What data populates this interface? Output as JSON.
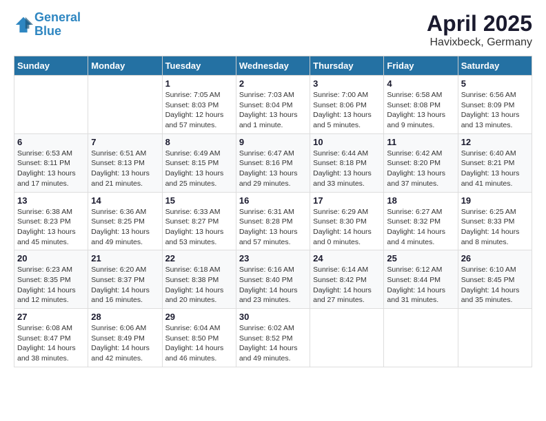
{
  "header": {
    "logo_line1": "General",
    "logo_line2": "Blue",
    "title": "April 2025",
    "subtitle": "Havixbeck, Germany"
  },
  "columns": [
    "Sunday",
    "Monday",
    "Tuesday",
    "Wednesday",
    "Thursday",
    "Friday",
    "Saturday"
  ],
  "weeks": [
    [
      {
        "day": "",
        "sunrise": "",
        "sunset": "",
        "daylight": ""
      },
      {
        "day": "",
        "sunrise": "",
        "sunset": "",
        "daylight": ""
      },
      {
        "day": "1",
        "sunrise": "Sunrise: 7:05 AM",
        "sunset": "Sunset: 8:03 PM",
        "daylight": "Daylight: 12 hours and 57 minutes."
      },
      {
        "day": "2",
        "sunrise": "Sunrise: 7:03 AM",
        "sunset": "Sunset: 8:04 PM",
        "daylight": "Daylight: 13 hours and 1 minute."
      },
      {
        "day": "3",
        "sunrise": "Sunrise: 7:00 AM",
        "sunset": "Sunset: 8:06 PM",
        "daylight": "Daylight: 13 hours and 5 minutes."
      },
      {
        "day": "4",
        "sunrise": "Sunrise: 6:58 AM",
        "sunset": "Sunset: 8:08 PM",
        "daylight": "Daylight: 13 hours and 9 minutes."
      },
      {
        "day": "5",
        "sunrise": "Sunrise: 6:56 AM",
        "sunset": "Sunset: 8:09 PM",
        "daylight": "Daylight: 13 hours and 13 minutes."
      }
    ],
    [
      {
        "day": "6",
        "sunrise": "Sunrise: 6:53 AM",
        "sunset": "Sunset: 8:11 PM",
        "daylight": "Daylight: 13 hours and 17 minutes."
      },
      {
        "day": "7",
        "sunrise": "Sunrise: 6:51 AM",
        "sunset": "Sunset: 8:13 PM",
        "daylight": "Daylight: 13 hours and 21 minutes."
      },
      {
        "day": "8",
        "sunrise": "Sunrise: 6:49 AM",
        "sunset": "Sunset: 8:15 PM",
        "daylight": "Daylight: 13 hours and 25 minutes."
      },
      {
        "day": "9",
        "sunrise": "Sunrise: 6:47 AM",
        "sunset": "Sunset: 8:16 PM",
        "daylight": "Daylight: 13 hours and 29 minutes."
      },
      {
        "day": "10",
        "sunrise": "Sunrise: 6:44 AM",
        "sunset": "Sunset: 8:18 PM",
        "daylight": "Daylight: 13 hours and 33 minutes."
      },
      {
        "day": "11",
        "sunrise": "Sunrise: 6:42 AM",
        "sunset": "Sunset: 8:20 PM",
        "daylight": "Daylight: 13 hours and 37 minutes."
      },
      {
        "day": "12",
        "sunrise": "Sunrise: 6:40 AM",
        "sunset": "Sunset: 8:21 PM",
        "daylight": "Daylight: 13 hours and 41 minutes."
      }
    ],
    [
      {
        "day": "13",
        "sunrise": "Sunrise: 6:38 AM",
        "sunset": "Sunset: 8:23 PM",
        "daylight": "Daylight: 13 hours and 45 minutes."
      },
      {
        "day": "14",
        "sunrise": "Sunrise: 6:36 AM",
        "sunset": "Sunset: 8:25 PM",
        "daylight": "Daylight: 13 hours and 49 minutes."
      },
      {
        "day": "15",
        "sunrise": "Sunrise: 6:33 AM",
        "sunset": "Sunset: 8:27 PM",
        "daylight": "Daylight: 13 hours and 53 minutes."
      },
      {
        "day": "16",
        "sunrise": "Sunrise: 6:31 AM",
        "sunset": "Sunset: 8:28 PM",
        "daylight": "Daylight: 13 hours and 57 minutes."
      },
      {
        "day": "17",
        "sunrise": "Sunrise: 6:29 AM",
        "sunset": "Sunset: 8:30 PM",
        "daylight": "Daylight: 14 hours and 0 minutes."
      },
      {
        "day": "18",
        "sunrise": "Sunrise: 6:27 AM",
        "sunset": "Sunset: 8:32 PM",
        "daylight": "Daylight: 14 hours and 4 minutes."
      },
      {
        "day": "19",
        "sunrise": "Sunrise: 6:25 AM",
        "sunset": "Sunset: 8:33 PM",
        "daylight": "Daylight: 14 hours and 8 minutes."
      }
    ],
    [
      {
        "day": "20",
        "sunrise": "Sunrise: 6:23 AM",
        "sunset": "Sunset: 8:35 PM",
        "daylight": "Daylight: 14 hours and 12 minutes."
      },
      {
        "day": "21",
        "sunrise": "Sunrise: 6:20 AM",
        "sunset": "Sunset: 8:37 PM",
        "daylight": "Daylight: 14 hours and 16 minutes."
      },
      {
        "day": "22",
        "sunrise": "Sunrise: 6:18 AM",
        "sunset": "Sunset: 8:38 PM",
        "daylight": "Daylight: 14 hours and 20 minutes."
      },
      {
        "day": "23",
        "sunrise": "Sunrise: 6:16 AM",
        "sunset": "Sunset: 8:40 PM",
        "daylight": "Daylight: 14 hours and 23 minutes."
      },
      {
        "day": "24",
        "sunrise": "Sunrise: 6:14 AM",
        "sunset": "Sunset: 8:42 PM",
        "daylight": "Daylight: 14 hours and 27 minutes."
      },
      {
        "day": "25",
        "sunrise": "Sunrise: 6:12 AM",
        "sunset": "Sunset: 8:44 PM",
        "daylight": "Daylight: 14 hours and 31 minutes."
      },
      {
        "day": "26",
        "sunrise": "Sunrise: 6:10 AM",
        "sunset": "Sunset: 8:45 PM",
        "daylight": "Daylight: 14 hours and 35 minutes."
      }
    ],
    [
      {
        "day": "27",
        "sunrise": "Sunrise: 6:08 AM",
        "sunset": "Sunset: 8:47 PM",
        "daylight": "Daylight: 14 hours and 38 minutes."
      },
      {
        "day": "28",
        "sunrise": "Sunrise: 6:06 AM",
        "sunset": "Sunset: 8:49 PM",
        "daylight": "Daylight: 14 hours and 42 minutes."
      },
      {
        "day": "29",
        "sunrise": "Sunrise: 6:04 AM",
        "sunset": "Sunset: 8:50 PM",
        "daylight": "Daylight: 14 hours and 46 minutes."
      },
      {
        "day": "30",
        "sunrise": "Sunrise: 6:02 AM",
        "sunset": "Sunset: 8:52 PM",
        "daylight": "Daylight: 14 hours and 49 minutes."
      },
      {
        "day": "",
        "sunrise": "",
        "sunset": "",
        "daylight": ""
      },
      {
        "day": "",
        "sunrise": "",
        "sunset": "",
        "daylight": ""
      },
      {
        "day": "",
        "sunrise": "",
        "sunset": "",
        "daylight": ""
      }
    ]
  ]
}
